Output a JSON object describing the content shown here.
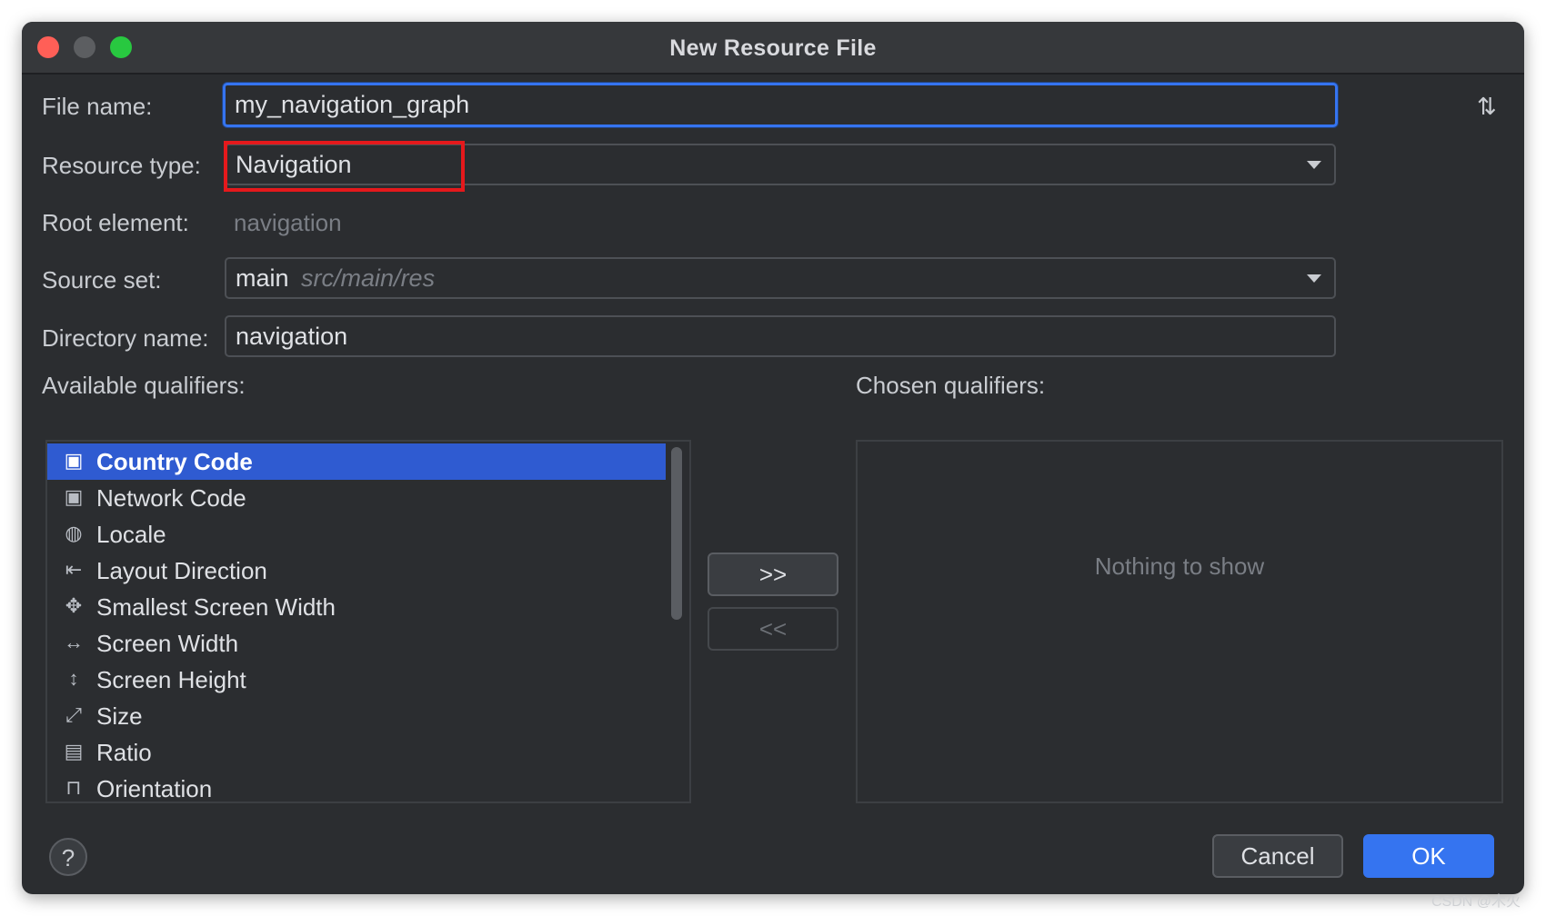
{
  "window": {
    "title": "New Resource File"
  },
  "form": {
    "file_name_label": "File name:",
    "file_name_value": "my_navigation_graph",
    "resource_type_label": "Resource type:",
    "resource_type_value": "Navigation",
    "root_element_label": "Root element:",
    "root_element_value": "navigation",
    "source_set_label": "Source set:",
    "source_set_value": "main",
    "source_set_path": "src/main/res",
    "directory_name_label": "Directory name:",
    "directory_name_value": "navigation"
  },
  "qualifiers": {
    "available_label": "Available qualifiers:",
    "chosen_label": "Chosen qualifiers:",
    "empty_text": "Nothing to show",
    "items": [
      {
        "label": "Country Code",
        "icon": "country-code-icon",
        "selected": true
      },
      {
        "label": "Network Code",
        "icon": "network-code-icon",
        "selected": false
      },
      {
        "label": "Locale",
        "icon": "globe-icon",
        "selected": false
      },
      {
        "label": "Layout Direction",
        "icon": "layout-direction-icon",
        "selected": false
      },
      {
        "label": "Smallest Screen Width",
        "icon": "smallest-screen-width-icon",
        "selected": false
      },
      {
        "label": "Screen Width",
        "icon": "screen-width-icon",
        "selected": false
      },
      {
        "label": "Screen Height",
        "icon": "screen-height-icon",
        "selected": false
      },
      {
        "label": "Size",
        "icon": "size-icon",
        "selected": false
      },
      {
        "label": "Ratio",
        "icon": "ratio-icon",
        "selected": false
      },
      {
        "label": "Orientation",
        "icon": "orientation-icon",
        "selected": false
      }
    ],
    "add_button_label": ">>",
    "remove_button_label": "<<"
  },
  "footer": {
    "help_label": "?",
    "cancel_label": "Cancel",
    "ok_label": "OK"
  },
  "colors": {
    "accent": "#3574f0",
    "selection": "#2f5bd1",
    "highlight_box": "#e5191c",
    "background": "#2b2d30"
  },
  "watermark": "CSDN @木火"
}
